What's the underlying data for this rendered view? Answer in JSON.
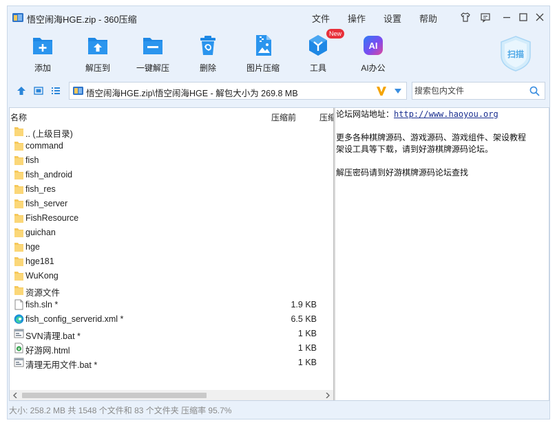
{
  "window": {
    "title": "悟空闹海HGE.zip - 360压缩",
    "menu": [
      "文件",
      "操作",
      "设置",
      "帮助"
    ]
  },
  "toolbar": {
    "items": [
      {
        "label": "添加",
        "icon": "add-icon"
      },
      {
        "label": "解压到",
        "icon": "extract-to-icon"
      },
      {
        "label": "一键解压",
        "icon": "one-click-extract-icon"
      },
      {
        "label": "删除",
        "icon": "trash-icon"
      },
      {
        "label": "图片压缩",
        "icon": "image-compress-icon"
      },
      {
        "label": "工具",
        "icon": "tools-icon"
      },
      {
        "label": "AI办公",
        "icon": "ai-office-icon"
      }
    ],
    "new_badge": "New",
    "ai_glyph": "AI",
    "scan_label": "扫描"
  },
  "address": {
    "path": "悟空闹海HGE.zip\\悟空闹海HGE - 解包大小为 269.8 MB"
  },
  "search": {
    "placeholder": "搜索包内文件"
  },
  "file_list": {
    "columns": {
      "name": "名称",
      "compressed": "压缩前",
      "after": "压缩"
    },
    "rows": [
      {
        "name": ".. (上级目录)",
        "size": "",
        "type": "folder"
      },
      {
        "name": "command",
        "size": "",
        "type": "folder"
      },
      {
        "name": "fish",
        "size": "",
        "type": "folder"
      },
      {
        "name": "fish_android",
        "size": "",
        "type": "folder"
      },
      {
        "name": "fish_res",
        "size": "",
        "type": "folder"
      },
      {
        "name": "fish_server",
        "size": "",
        "type": "folder"
      },
      {
        "name": "FishResource",
        "size": "",
        "type": "folder"
      },
      {
        "name": "guichan",
        "size": "",
        "type": "folder"
      },
      {
        "name": "hge",
        "size": "",
        "type": "folder"
      },
      {
        "name": "hge181",
        "size": "",
        "type": "folder"
      },
      {
        "name": "WuKong",
        "size": "",
        "type": "folder"
      },
      {
        "name": "资源文件",
        "size": "",
        "type": "folder"
      },
      {
        "name": "fish.sln *",
        "size": "1.9 KB",
        "type": "file"
      },
      {
        "name": "fish_config_serverid.xml *",
        "size": "6.5 KB",
        "type": "edge"
      },
      {
        "name": "SVN清理.bat *",
        "size": "1 KB",
        "type": "bat"
      },
      {
        "name": "好游网.html",
        "size": "1 KB",
        "type": "html"
      },
      {
        "name": "清理无用文件.bat *",
        "size": "1 KB",
        "type": "bat"
      }
    ]
  },
  "info": {
    "forum_label": "论坛网站地址：",
    "forum_url": "http://www.haoyou.org",
    "line2": "更多各种棋牌源码、游戏源码、游戏组件、架设教程",
    "line3": "架设工具等下载，请到好游棋牌源码论坛。",
    "line4": "解压密码请到好游棋牌源码论坛查找"
  },
  "status": {
    "text": "大小: 258.2 MB 共 1548 个文件和 83 个文件夹 压缩率 95.7%"
  },
  "colors": {
    "accent_blue": "#1e88e5",
    "toolbar_bg": "#e9f1fb",
    "folder": "#f6c85a",
    "badge_red": "#e8303a",
    "vlogo_orange": "#f5a400"
  }
}
